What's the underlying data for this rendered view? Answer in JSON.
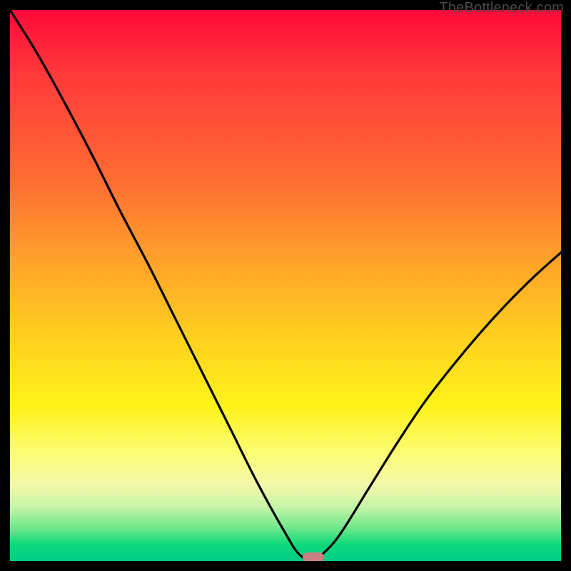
{
  "attribution": "TheBottleneck.com",
  "colors": {
    "frame_bg": "#000000",
    "gradient_top": "#ff0a3a",
    "gradient_bottom": "#00cc88",
    "curve_stroke": "#000000",
    "pill_fill": "#c98080"
  },
  "chart_data": {
    "type": "line",
    "title": "",
    "xlabel": "",
    "ylabel": "",
    "xlim": [
      0,
      100
    ],
    "ylim": [
      0,
      100
    ],
    "series": [
      {
        "name": "bottleneck-curve",
        "x": [
          0,
          5,
          10,
          15,
          20,
          25,
          30,
          35,
          40,
          45,
          50,
          52.5,
          55,
          57,
          60,
          65,
          70,
          75,
          80,
          85,
          90,
          95,
          100
        ],
        "values": [
          100,
          92,
          83,
          73.5,
          63.5,
          54,
          44,
          34,
          24,
          14,
          5,
          1.2,
          0,
          1.5,
          5,
          13,
          21,
          28.5,
          35,
          41,
          46.5,
          51.5,
          56
        ]
      }
    ],
    "annotations": [
      {
        "type": "pill",
        "x": 55,
        "y": 0,
        "color": "#c98080"
      }
    ]
  }
}
